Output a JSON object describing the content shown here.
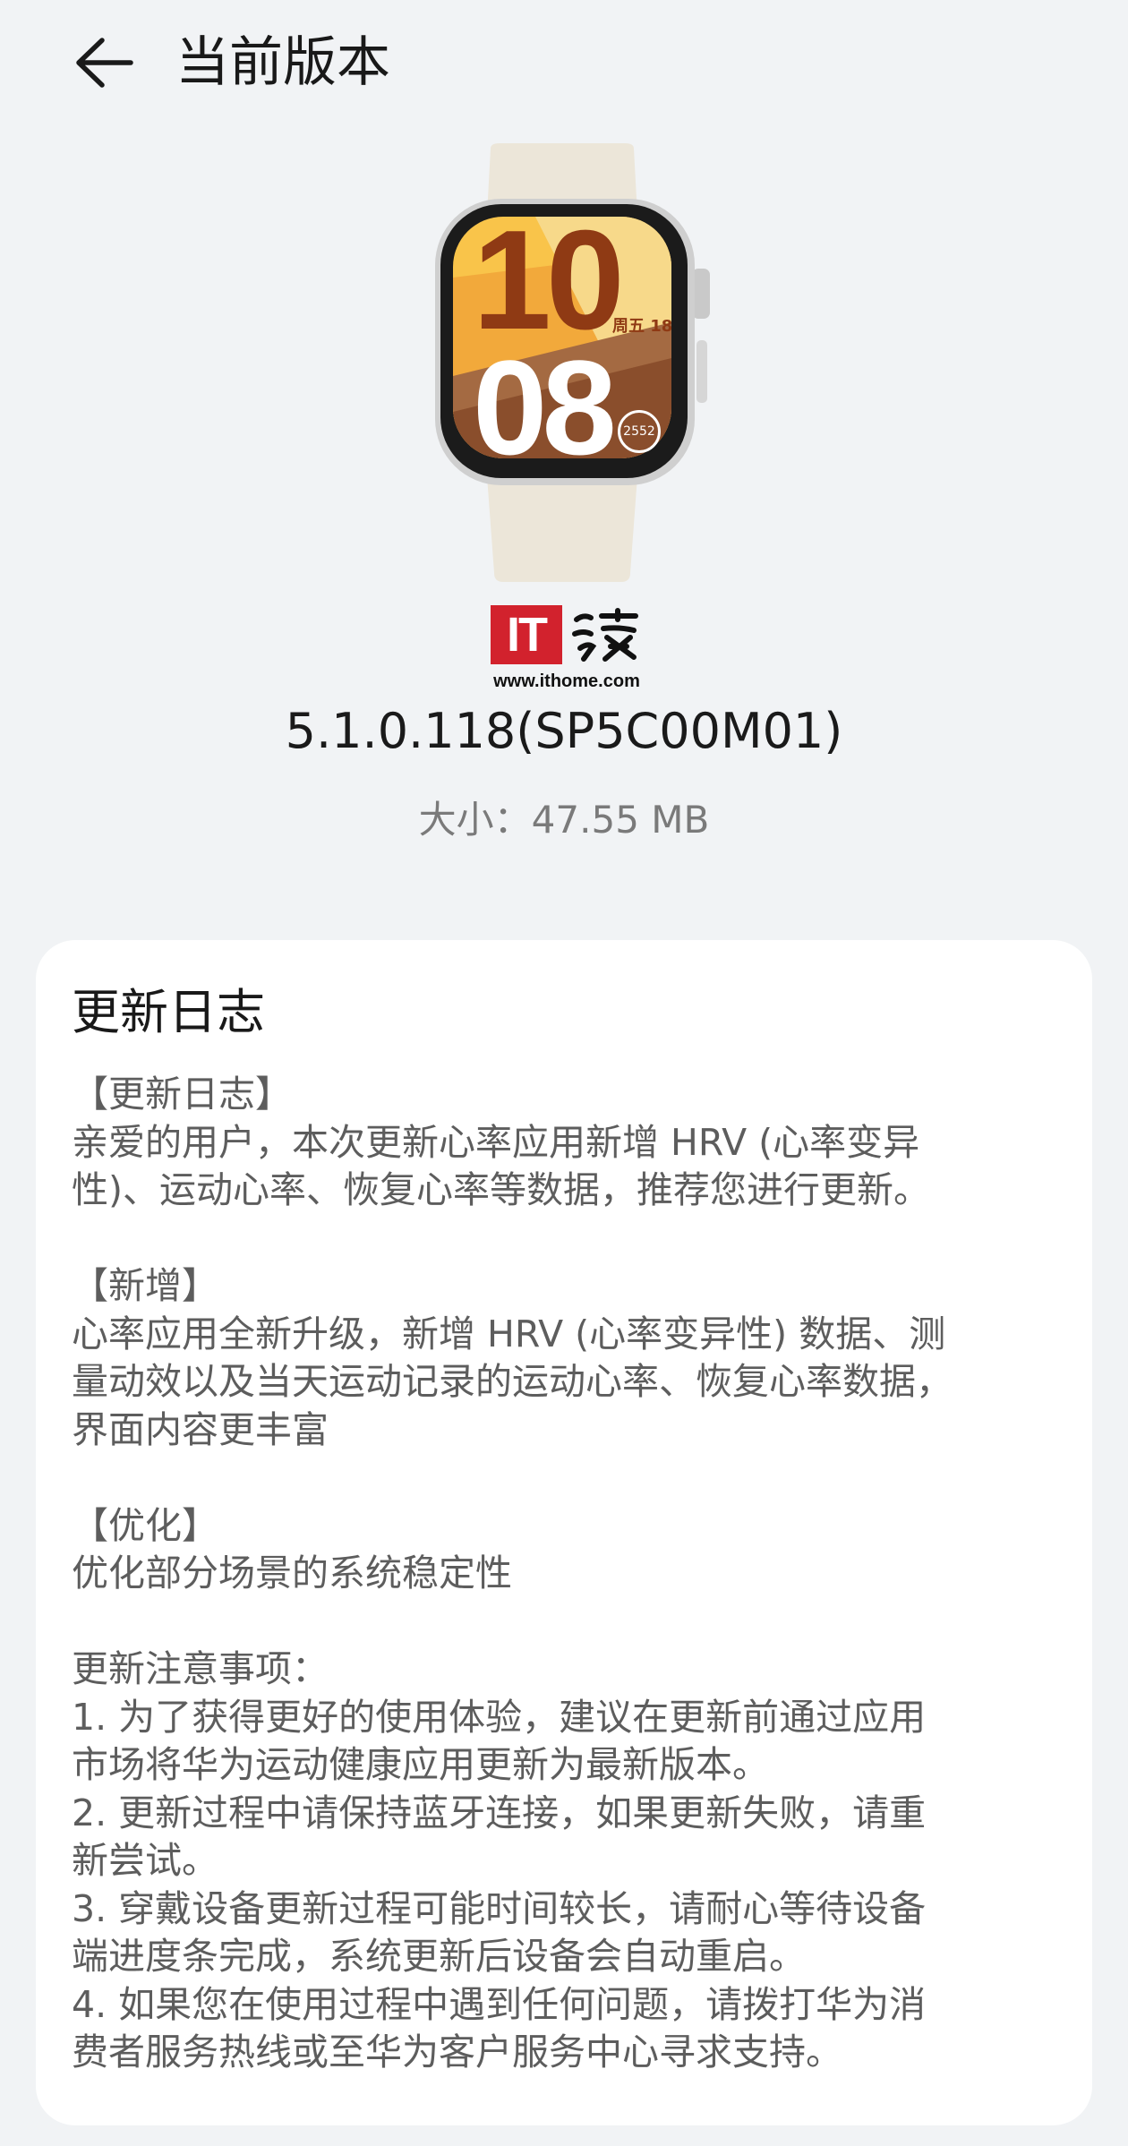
{
  "header": {
    "title": "当前版本",
    "back_icon": "arrow-left-icon"
  },
  "logo": {
    "brand": "IT之家",
    "mark_text": "IT",
    "url": "www.ithome.com"
  },
  "watch_face": {
    "hour": "10",
    "minute": "08",
    "date": "周五 18",
    "steps": "2552"
  },
  "version_info": {
    "version": "5.1.0.118(SP5C00M01)",
    "size": "大小：47.55 MB"
  },
  "changelog": {
    "title": "更新日志",
    "lines": [
      "【更新日志】",
      "亲爱的用户，本次更新心率应用新增 HRV (心率变异",
      "性)、运动心率、恢复心率等数据，推荐您进行更新。",
      "",
      "【新增】",
      "心率应用全新升级，新增 HRV (心率变异性) 数据、测",
      "量动效以及当天运动记录的运动心率、恢复心率数据，",
      "界面内容更丰富",
      "",
      "【优化】",
      "优化部分场景的系统稳定性",
      "",
      "更新注意事项：",
      "1. 为了获得更好的使用体验，建议在更新前通过应用",
      "市场将华为运动健康应用更新为最新版本。",
      "2. 更新过程中请保持蓝牙连接，如果更新失败，请重",
      "新尝试。",
      "3. 穿戴设备更新过程可能时间较长，请耐心等待设备",
      "端进度条完成，系统更新后设备会自动重启。",
      "4. 如果您在使用过程中遇到任何问题，请拨打华为消",
      "费者服务热线或至华为客户服务中心寻求支持。"
    ]
  },
  "colors": {
    "background": "#f1f3f5",
    "card": "#ffffff",
    "text_primary": "#191919",
    "text_secondary": "#5d5d5d",
    "logo_red": "#d2222d"
  }
}
